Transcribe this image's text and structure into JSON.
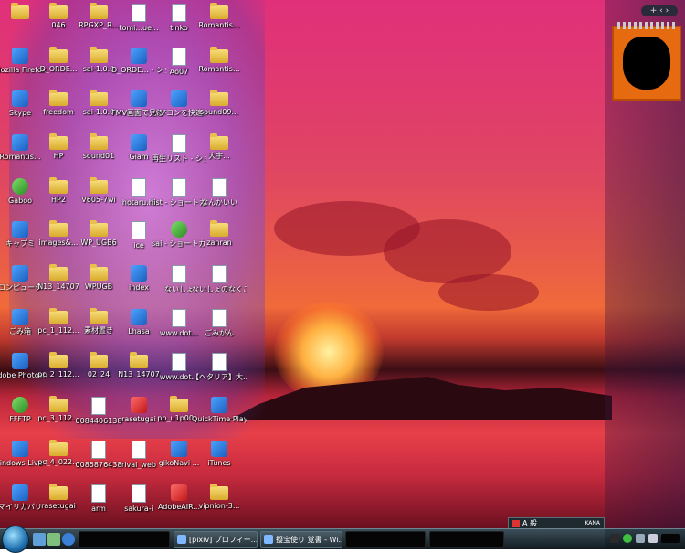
{
  "desktop": {
    "icons": [
      {
        "label": "",
        "kind": "folder"
      },
      {
        "label": "046",
        "kind": "folder"
      },
      {
        "label": "RPGXP_R...",
        "kind": "folder"
      },
      {
        "label": "tomi...ue...",
        "kind": "doc"
      },
      {
        "label": "tinko",
        "kind": "doc"
      },
      {
        "label": "Romantis...",
        "kind": "folder"
      },
      {
        "label": "Mozilla Firefox",
        "kind": "app"
      },
      {
        "label": "D_ORDE...",
        "kind": "folder"
      },
      {
        "label": "sai-1.0.0",
        "kind": "folder"
      },
      {
        "label": "D_ORDE... - ショー...",
        "kind": "app"
      },
      {
        "label": "Ao07",
        "kind": "doc"
      },
      {
        "label": "Romantis...",
        "kind": "folder"
      },
      {
        "label": "Skype",
        "kind": "app"
      },
      {
        "label": "freedom",
        "kind": "folder"
      },
      {
        "label": "sai-1.0.0",
        "kind": "folder"
      },
      {
        "label": "FMV画面で見るマ...",
        "kind": "app"
      },
      {
        "label": "パソコンを快適...",
        "kind": "app"
      },
      {
        "label": "sound09...",
        "kind": "folder"
      },
      {
        "label": "Romantis...",
        "kind": "app"
      },
      {
        "label": "HP",
        "kind": "folder"
      },
      {
        "label": "sound01",
        "kind": "folder"
      },
      {
        "label": "Giam",
        "kind": "app"
      },
      {
        "label": "再生リスト - ショート...",
        "kind": "doc"
      },
      {
        "label": "大宇...",
        "kind": "folder"
      },
      {
        "label": "Gaboo",
        "kind": "greenbox"
      },
      {
        "label": "HP2",
        "kind": "folder"
      },
      {
        "label": "V605-7wi",
        "kind": "folder"
      },
      {
        "label": "hotaru.hi",
        "kind": "doc"
      },
      {
        "label": "list - ショートカット",
        "kind": "doc"
      },
      {
        "label": "なんかいい",
        "kind": "doc"
      },
      {
        "label": "キャプミ",
        "kind": "app"
      },
      {
        "label": "images&...",
        "kind": "folder"
      },
      {
        "label": "WP_UGB6",
        "kind": "folder"
      },
      {
        "label": "ice",
        "kind": "doc"
      },
      {
        "label": "sai - ショートカット",
        "kind": "greenbox"
      },
      {
        "label": "zanran",
        "kind": "folder"
      },
      {
        "label": "コンピュータ",
        "kind": "app"
      },
      {
        "label": "N13_14707",
        "kind": "folder"
      },
      {
        "label": "WPUGB",
        "kind": "folder"
      },
      {
        "label": "index",
        "kind": "app"
      },
      {
        "label": "ないしょ",
        "kind": "doc"
      },
      {
        "label": "ないしょのなくこ...",
        "kind": "doc"
      },
      {
        "label": "ごみ箱",
        "kind": "app"
      },
      {
        "label": "pc_1_112...",
        "kind": "folder"
      },
      {
        "label": "素材置き",
        "kind": "folder"
      },
      {
        "label": "Lhasa",
        "kind": "app"
      },
      {
        "label": "www.dot...",
        "kind": "doc"
      },
      {
        "label": "ごみがん",
        "kind": "doc"
      },
      {
        "label": "Adobe Photosh...",
        "kind": "app"
      },
      {
        "label": "pc_2_112...",
        "kind": "folder"
      },
      {
        "label": "02_24",
        "kind": "folder"
      },
      {
        "label": "N13_14707",
        "kind": "folder"
      },
      {
        "label": "www.dot...",
        "kind": "doc"
      },
      {
        "label": "【ヘタリア】大...",
        "kind": "doc"
      },
      {
        "label": "FFFTP",
        "kind": "greenbox"
      },
      {
        "label": "pc_3_112...",
        "kind": "folder"
      },
      {
        "label": "0084406138",
        "kind": "doc"
      },
      {
        "label": "rasetugai",
        "kind": "redbox"
      },
      {
        "label": "pp_u1p00...",
        "kind": "folder"
      },
      {
        "label": "QuickTime Player",
        "kind": "app"
      },
      {
        "label": "Windows Live Mes...",
        "kind": "app"
      },
      {
        "label": "pc_4_022...",
        "kind": "folder"
      },
      {
        "label": "0085876438",
        "kind": "doc"
      },
      {
        "label": "rival_web",
        "kind": "doc"
      },
      {
        "label": "gikoNavi ...",
        "kind": "app"
      },
      {
        "label": "iTunes",
        "kind": "app"
      },
      {
        "label": "マイリカバリ",
        "kind": "app"
      },
      {
        "label": "rasetugai",
        "kind": "folder"
      },
      {
        "label": "arm",
        "kind": "doc"
      },
      {
        "label": "sakura-i",
        "kind": "doc"
      },
      {
        "label": "AdobeAIR...",
        "kind": "redbox"
      },
      {
        "label": "vipnion-3...",
        "kind": "folder"
      }
    ]
  },
  "sidebar": {
    "controls": "+ ‹ ›"
  },
  "languagebar": {
    "text": "A 般",
    "mode": "KANA"
  },
  "taskbar": {
    "buttons": [
      {
        "label": "",
        "style": "black"
      },
      {
        "label": "[pixiv] プロフィー...",
        "style": "normal"
      },
      {
        "label": "擬宝使り 覚書 - Wi...",
        "style": "normal"
      },
      {
        "label": "",
        "style": "black"
      },
      {
        "label": "",
        "style": "black"
      }
    ]
  }
}
